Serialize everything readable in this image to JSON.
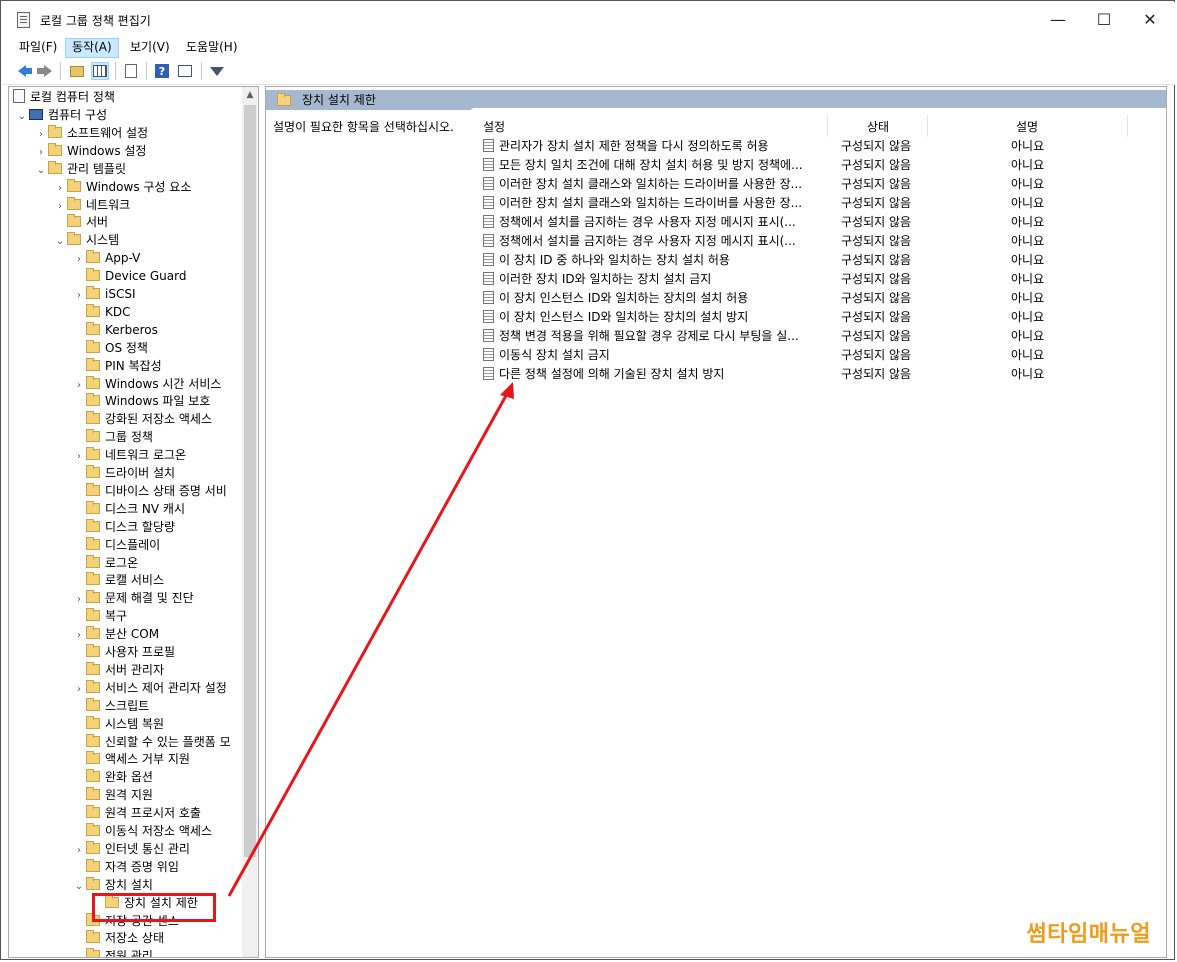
{
  "window": {
    "title": "로컬 그룹 정책 편집기",
    "minimize": "—",
    "maximize": "☐",
    "close": "✕"
  },
  "menu": [
    {
      "label": "파일(F)"
    },
    {
      "label": "동작(A)"
    },
    {
      "label": "보기(V)"
    },
    {
      "label": "도움말(H)"
    }
  ],
  "tree": {
    "root": "로컬 컴퓨터 정책",
    "items": [
      "컴퓨터 구성",
      "소프트웨어 설정",
      "Windows 설정",
      "관리 템플릿",
      "Windows 구성 요소",
      "네트워크",
      "서버",
      "시스템",
      "App-V",
      "Device Guard",
      "iSCSI",
      "KDC",
      "Kerberos",
      "OS 정책",
      "PIN 복잡성",
      "Windows 시간 서비스",
      "Windows 파일 보호",
      "강화된 저장소 액세스",
      "그룹 정책",
      "네트워크 로그온",
      "드라이버 설치",
      "디바이스 상태 증명 서비",
      "디스크 NV 캐시",
      "디스크 할당량",
      "디스플레이",
      "로그온",
      "로캘 서비스",
      "문제 해결 및 진단",
      "복구",
      "분산 COM",
      "사용자 프로필",
      "서버 관리자",
      "서비스 제어 관리자 설정",
      "스크립트",
      "시스템 복원",
      "신뢰할 수 있는 플랫폼 모",
      "액세스 거부 지원",
      "완화 옵션",
      "원격 지원",
      "원격 프로시저 호출",
      "이동식 저장소 액세스",
      "인터넷 통신 관리",
      "자격 증명 위임",
      "장치 설치",
      "장치 설치 제한",
      "저장 공간 센스",
      "저장소 상태",
      "전원 관리"
    ]
  },
  "right": {
    "header": "장치 설치 제한",
    "description": "설명이 필요한 항목을 선택하십시오.",
    "columns": {
      "name": "설정",
      "state": "상태",
      "comment": "설명"
    },
    "rows": [
      {
        "name": "관리자가 장치 설치 제한 정책을 다시 정의하도록 허용",
        "state": "구성되지 않음",
        "comment": "아니요"
      },
      {
        "name": "모든 장치 일치 조건에 대해 장치 설치 허용 및 방지 정책에...",
        "state": "구성되지 않음",
        "comment": "아니요"
      },
      {
        "name": "이러한 장치 설치 클래스와 일치하는 드라이버를 사용한 장...",
        "state": "구성되지 않음",
        "comment": "아니요"
      },
      {
        "name": "이러한 장치 설치 클래스와 일치하는 드라이버를 사용한 장...",
        "state": "구성되지 않음",
        "comment": "아니요"
      },
      {
        "name": "정책에서 설치를 금지하는 경우 사용자 지정 메시지 표시(...",
        "state": "구성되지 않음",
        "comment": "아니요"
      },
      {
        "name": "정책에서 설치를 금지하는 경우 사용자 지정 메시지 표시(...",
        "state": "구성되지 않음",
        "comment": "아니요"
      },
      {
        "name": "이 장치 ID 중 하나와 일치하는 장치 설치 허용",
        "state": "구성되지 않음",
        "comment": "아니요"
      },
      {
        "name": "이러한 장치 ID와 일치하는 장치 설치 금지",
        "state": "구성되지 않음",
        "comment": "아니요"
      },
      {
        "name": "이 장치 인스턴스 ID와 일치하는 장치의 설치 허용",
        "state": "구성되지 않음",
        "comment": "아니요"
      },
      {
        "name": "이 장치 인스턴스 ID와 일치하는 장치의 설치 방지",
        "state": "구성되지 않음",
        "comment": "아니요"
      },
      {
        "name": "정책 변경 적용을 위해 필요할 경우 강제로 다시 부팅을 실...",
        "state": "구성되지 않음",
        "comment": "아니요"
      },
      {
        "name": "이동식 장치 설치 금지",
        "state": "구성되지 않음",
        "comment": "아니요"
      },
      {
        "name": "다른 정책 설정에 의해 기술된 장치 설치 방지",
        "state": "구성되지 않음",
        "comment": "아니요"
      }
    ]
  },
  "watermark": "썸타임매뉴얼",
  "colors": {
    "header_bg": "#a6b8cf",
    "annotation": "#e8151b",
    "watermark": "#f29a1b",
    "selected_menu": "#cce8ff"
  }
}
